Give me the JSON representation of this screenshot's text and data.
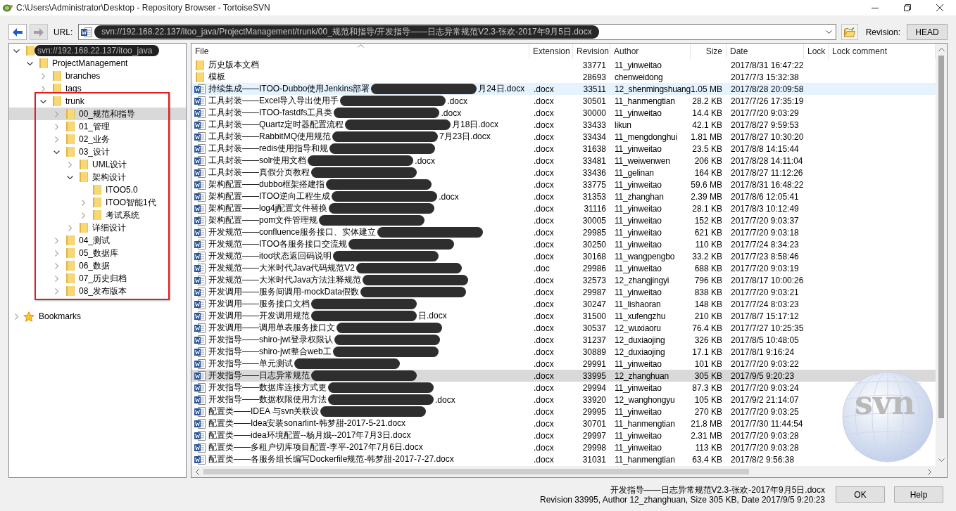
{
  "window": {
    "title": "C:\\Users\\Administrator\\Desktop - Repository Browser - TortoiseSVN"
  },
  "toolbar": {
    "back": {
      "disabled": false
    },
    "forward": {
      "disabled": true
    },
    "url_label": "URL:",
    "url": {
      "value": "svn://192.168.22.137/itoo_java/ProjectManagement/trunk/00_规范和指导/开发指导——日志异常规范V2.3-张欢-2017年9月5日.docx",
      "redacted": true
    },
    "revision_label": "Revision:",
    "revision_button": "HEAD"
  },
  "tree": {
    "items": [
      {
        "label": "svn://192.168.22.137/itoo_java",
        "redacted": true,
        "has_children": true,
        "expanded": true,
        "selected": false,
        "children": [
          {
            "label": "ProjectManagement",
            "has_children": true,
            "expanded": true,
            "selected": false,
            "children": [
              {
                "label": "branches",
                "has_children": true,
                "expanded": false,
                "selected": false
              },
              {
                "label": "tags",
                "has_children": true,
                "expanded": false,
                "selected": false
              },
              {
                "label": "trunk",
                "has_children": true,
                "expanded": true,
                "selected": false,
                "children": [
                  {
                    "label": "00_规范和指导",
                    "has_children": true,
                    "expanded": false,
                    "selected": true
                  },
                  {
                    "label": "01_管理",
                    "has_children": true,
                    "expanded": false,
                    "selected": false
                  },
                  {
                    "label": "02_业务",
                    "has_children": true,
                    "expanded": false,
                    "selected": false
                  },
                  {
                    "label": "03_设计",
                    "has_children": true,
                    "expanded": true,
                    "selected": false,
                    "children": [
                      {
                        "label": "UML设计",
                        "has_children": true,
                        "expanded": false,
                        "selected": false
                      },
                      {
                        "label": "架构设计",
                        "has_children": true,
                        "expanded": true,
                        "selected": false,
                        "children": [
                          {
                            "label": "ITOO5.0",
                            "has_children": false,
                            "selected": false
                          },
                          {
                            "label": "ITOO智能1代",
                            "has_children": true,
                            "expanded": false,
                            "selected": false
                          },
                          {
                            "label": "考试系统",
                            "has_children": true,
                            "expanded": false,
                            "selected": false
                          }
                        ]
                      },
                      {
                        "label": "详细设计",
                        "has_children": true,
                        "expanded": false,
                        "selected": false
                      }
                    ]
                  },
                  {
                    "label": "04_测试",
                    "has_children": true,
                    "expanded": false,
                    "selected": false
                  },
                  {
                    "label": "05_数据库",
                    "has_children": true,
                    "expanded": false,
                    "selected": false
                  },
                  {
                    "label": "06_数据",
                    "has_children": true,
                    "expanded": false,
                    "selected": false
                  },
                  {
                    "label": "07_历史归档",
                    "has_children": true,
                    "expanded": false,
                    "selected": false
                  },
                  {
                    "label": "08_发布版本",
                    "has_children": true,
                    "expanded": false,
                    "selected": false
                  }
                ]
              }
            ]
          }
        ]
      }
    ],
    "bookmarks": {
      "label": "Bookmarks",
      "expanded": false
    }
  },
  "file_list": {
    "columns": [
      "File",
      "Extension",
      "Revision",
      "Author",
      "Size",
      "Date",
      "Lock",
      "Lock comment"
    ],
    "logo_text": "svn",
    "rows": [
      {
        "kind": "folder",
        "name": "历史版本文档",
        "redacted": false,
        "revision": "33771",
        "author": "11_yinweitao",
        "date": "2017/8/31 16:47:22",
        "selected": false,
        "hovered": false
      },
      {
        "kind": "folder",
        "name": "模板",
        "redacted": false,
        "revision": "28693",
        "author": "chenweidong",
        "date": "2017/7/3 15:32:38",
        "selected": false,
        "hovered": false
      },
      {
        "kind": "word",
        "name": "持续集成——ITOO-Dubbo使用Jenkins部署",
        "redacted": true,
        "name_tail": "月24日.docx",
        "extension": ".docx",
        "revision": "33511",
        "author": "12_shenmingshuang",
        "size": "1.05 MB",
        "date": "2017/8/28 20:09:58",
        "selected": false,
        "hovered": true
      },
      {
        "kind": "word",
        "name": "工具封装——Excel导入导出使用手",
        "redacted": true,
        "name_tail": ".docx",
        "extension": ".docx",
        "revision": "30501",
        "author": "11_hanmengtian",
        "size": "28.2 KB",
        "date": "2017/7/26 17:35:19",
        "selected": false,
        "hovered": false
      },
      {
        "kind": "word",
        "name": "工具封装——ITOO-fastdfs工具类",
        "redacted": true,
        "name_tail": ".docx",
        "extension": ".docx",
        "revision": "30000",
        "author": "11_yinweitao",
        "size": "14.4 KB",
        "date": "2017/7/20 9:03:29",
        "selected": false,
        "hovered": false
      },
      {
        "kind": "word",
        "name": "工具封装——Quartz定时器配置流程",
        "redacted": true,
        "name_tail": "月18日.docx",
        "extension": ".docx",
        "revision": "33433",
        "author": "likun",
        "size": "42.1 KB",
        "date": "2017/8/27 9:59:53",
        "selected": false,
        "hovered": false
      },
      {
        "kind": "word",
        "name": "工具封装——RabbitMQ使用规范",
        "redacted": true,
        "name_tail": "7月23日.docx",
        "extension": ".docx",
        "revision": "33434",
        "author": "11_mengdonghui",
        "size": "1.81 MB",
        "date": "2017/8/27 10:30:20",
        "selected": false,
        "hovered": false
      },
      {
        "kind": "word",
        "name": "工具封装——redis使用指导和规",
        "redacted": true,
        "extension": ".docx",
        "revision": "31638",
        "author": "11_yinweitao",
        "size": "23.5 KB",
        "date": "2017/8/8 14:15:44",
        "selected": false,
        "hovered": false
      },
      {
        "kind": "word",
        "name": "工具封装——solr使用文档",
        "redacted": true,
        "name_tail": ".docx",
        "extension": ".docx",
        "revision": "33481",
        "author": "11_weiwenwen",
        "size": "206 KB",
        "date": "2017/8/28 14:11:04",
        "selected": false,
        "hovered": false
      },
      {
        "kind": "word",
        "name": "工具封装——真假分页教程",
        "redacted": true,
        "extension": ".docx",
        "revision": "33436",
        "author": "11_gelinan",
        "size": "164 KB",
        "date": "2017/8/27 11:12:26",
        "selected": false,
        "hovered": false
      },
      {
        "kind": "word",
        "name": "架构配置——dubbo框架搭建指",
        "redacted": true,
        "extension": ".docx",
        "revision": "33775",
        "author": "11_yinweitao",
        "size": "59.6 MB",
        "date": "2017/8/31 16:48:22",
        "selected": false,
        "hovered": false
      },
      {
        "kind": "word",
        "name": "架构配置——ITOO逆向工程生成",
        "redacted": true,
        "name_tail": ".docx",
        "extension": ".docx",
        "revision": "31353",
        "author": "11_zhanghan",
        "size": "2.39 MB",
        "date": "2017/8/6 12:05:41",
        "selected": false,
        "hovered": false
      },
      {
        "kind": "word",
        "name": "架构配置——log4j配置文件替换",
        "redacted": true,
        "extension": ".docx",
        "revision": "31116",
        "author": "11_yinweitao",
        "size": "28.1 KB",
        "date": "2017/8/3 10:12:49",
        "selected": false,
        "hovered": false
      },
      {
        "kind": "word",
        "name": "架构配置——pom文件管理规",
        "redacted": true,
        "extension": ".docx",
        "revision": "30005",
        "author": "11_yinweitao",
        "size": "152 KB",
        "date": "2017/7/20 9:03:37",
        "selected": false,
        "hovered": false
      },
      {
        "kind": "word",
        "name": "开发规范——confluence服务接口、实体建立",
        "redacted": true,
        "extension": ".docx",
        "revision": "29985",
        "author": "11_yinweitao",
        "size": "621 KB",
        "date": "2017/7/20 9:03:18",
        "selected": false,
        "hovered": false
      },
      {
        "kind": "word",
        "name": "开发规范——ITOO各服务接口交流规",
        "redacted": true,
        "extension": ".docx",
        "revision": "30250",
        "author": "11_yinweitao",
        "size": "110 KB",
        "date": "2017/7/24 8:34:23",
        "selected": false,
        "hovered": false
      },
      {
        "kind": "word",
        "name": "开发规范——itoo状态返回码说明",
        "redacted": true,
        "extension": ".docx",
        "revision": "30168",
        "author": "11_wangpengbo",
        "size": "33.2 KB",
        "date": "2017/7/23 8:58:46",
        "selected": false,
        "hovered": false
      },
      {
        "kind": "word",
        "name": "开发规范——大米时代Java代码规范V2",
        "redacted": true,
        "extension": ".doc",
        "revision": "29986",
        "author": "11_yinweitao",
        "size": "688 KB",
        "date": "2017/7/20 9:03:19",
        "selected": false,
        "hovered": false
      },
      {
        "kind": "word",
        "name": "开发规范——大米时代Java方法注释规范",
        "redacted": true,
        "extension": ".docx",
        "revision": "32573",
        "author": "12_zhangjingyi",
        "size": "796 KB",
        "date": "2017/8/17 10:00:26",
        "selected": false,
        "hovered": false
      },
      {
        "kind": "word",
        "name": "开发调用——服务间调用-mockData假数",
        "redacted": true,
        "extension": ".docx",
        "revision": "29987",
        "author": "11_yinweitao",
        "size": "838 KB",
        "date": "2017/7/20 9:03:21",
        "selected": false,
        "hovered": false
      },
      {
        "kind": "word",
        "name": "开发调用——服务接口文档",
        "redacted": true,
        "extension": ".docx",
        "revision": "30247",
        "author": "11_lishaoran",
        "size": "148 KB",
        "date": "2017/7/24 8:03:23",
        "selected": false,
        "hovered": false
      },
      {
        "kind": "word",
        "name": "开发调用——开发调用规范",
        "redacted": true,
        "name_tail": "日.docx",
        "extension": ".docx",
        "revision": "31500",
        "author": "11_xufengzhu",
        "size": "210 KB",
        "date": "2017/8/7 15:17:12",
        "selected": false,
        "hovered": false
      },
      {
        "kind": "word",
        "name": "开发调用——调用单表服务接口文",
        "redacted": true,
        "extension": ".docx",
        "revision": "30537",
        "author": "12_wuxiaoru",
        "size": "76.4 KB",
        "date": "2017/7/27 10:25:35",
        "selected": false,
        "hovered": false
      },
      {
        "kind": "word",
        "name": "开发指导——shiro-jwt登录权限认",
        "redacted": true,
        "extension": ".docx",
        "revision": "31237",
        "author": "12_duxiaojing",
        "size": "326 KB",
        "date": "2017/8/5 10:48:05",
        "selected": false,
        "hovered": false
      },
      {
        "kind": "word",
        "name": "开发指导——shiro-jwt整合web工",
        "redacted": true,
        "extension": ".docx",
        "revision": "30889",
        "author": "12_duxiaojing",
        "size": "17.1 KB",
        "date": "2017/8/1 9:16:24",
        "selected": false,
        "hovered": false
      },
      {
        "kind": "word",
        "name": "开发指导——单元测试",
        "redacted": true,
        "extension": ".docx",
        "revision": "29991",
        "author": "11_yinweitao",
        "size": "101 KB",
        "date": "2017/7/20 9:03:22",
        "selected": false,
        "hovered": false
      },
      {
        "kind": "word",
        "name": "开发指导——日志异常规范",
        "redacted": true,
        "extension": ".docx",
        "revision": "33995",
        "author": "12_zhanghuan",
        "size": "305 KB",
        "date": "2017/9/5 9:20:23",
        "selected": true,
        "hovered": false
      },
      {
        "kind": "word",
        "name": "开发指导——数据库连接方式更",
        "redacted": true,
        "extension": ".docx",
        "revision": "29994",
        "author": "11_yinweitao",
        "size": "87.3 KB",
        "date": "2017/7/20 9:03:24",
        "selected": false,
        "hovered": false
      },
      {
        "kind": "word",
        "name": "开发指导——数据权限使用方法",
        "redacted": true,
        "name_tail": ".docx",
        "extension": ".docx",
        "revision": "33920",
        "author": "12_wanghongyu",
        "size": "105 KB",
        "date": "2017/9/2 21:14:07",
        "selected": false,
        "hovered": false
      },
      {
        "kind": "word",
        "name": "配置类——IDEA 与svn关联设",
        "redacted": true,
        "extension": ".docx",
        "revision": "29995",
        "author": "11_yinweitao",
        "size": "270 KB",
        "date": "2017/7/20 9:03:25",
        "selected": false,
        "hovered": false
      },
      {
        "kind": "word",
        "name": "配置类——Idea安装sonarlint-韩梦甜-2017-5-21.docx",
        "redacted": false,
        "extension": ".docx",
        "revision": "30701",
        "author": "11_hanmengtian",
        "size": "21.8 MB",
        "date": "2017/7/30 11:44:54",
        "selected": false,
        "hovered": false
      },
      {
        "kind": "word",
        "name": "配置类——idea环境配置--杨月娥--2017年7月3日.docx",
        "redacted": false,
        "extension": ".docx",
        "revision": "29997",
        "author": "11_yinweitao",
        "size": "2.31 MB",
        "date": "2017/7/20 9:03:28",
        "selected": false,
        "hovered": false
      },
      {
        "kind": "word",
        "name": "配置类——多租户切库项目配置-李平-2017年7月6日.docx",
        "redacted": false,
        "extension": ".docx",
        "revision": "29998",
        "author": "11_yinweitao",
        "size": "113 KB",
        "date": "2017/7/20 9:03:28",
        "selected": false,
        "hovered": false
      },
      {
        "kind": "word",
        "name": "配置类——各服务组长编写Dockerfile规范-韩梦甜-2017-7-27.docx",
        "redacted": false,
        "extension": ".docx",
        "revision": "31031",
        "author": "11_hanmengtian",
        "size": "63.4 KB",
        "date": "2017/8/2 9:56:38",
        "selected": false,
        "hovered": false
      }
    ]
  },
  "status": {
    "lines": [
      "开发指导——日志异常规范V2.3-张欢-2017年9月5日.docx",
      "Revision 33995, Author 12_zhanghuan, Size 305 KB, Date 2017/9/5 9:20:23"
    ]
  },
  "buttons": [
    "OK",
    "Help"
  ]
}
